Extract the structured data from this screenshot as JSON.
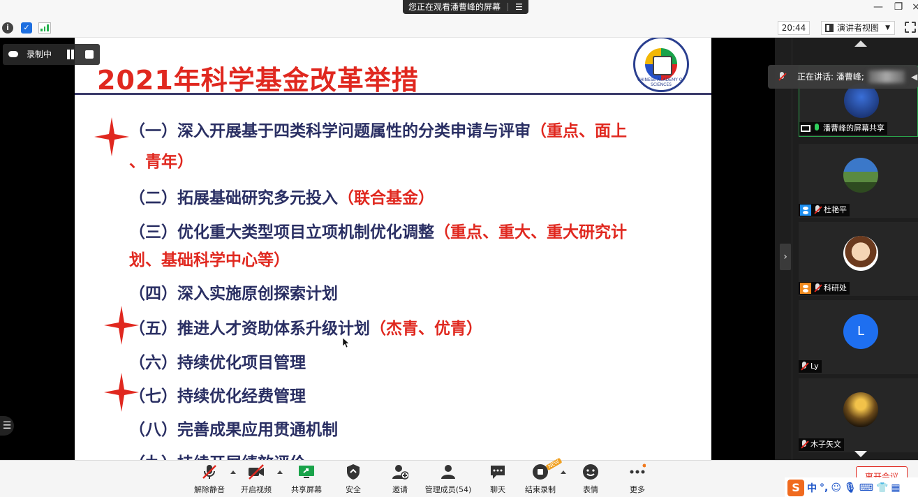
{
  "window": {
    "share_banner": "您正在观看潘曹峰的屏幕",
    "menu_glyph": "☰"
  },
  "toolbar": {
    "clock": "20:44",
    "view_mode": "演讲者视图"
  },
  "recording_badge": {
    "label": "录制中"
  },
  "slide": {
    "title": "2021年科学基金改革举措",
    "logo_text": "CHINESE ACADEMY OF SCIENCES",
    "items": [
      {
        "text": "（一）深入开展基于四类科学问题属性的分类申请与评审",
        "red": "（重点、面上",
        "cont": "、青年）"
      },
      {
        "text": "（二）拓展基础研究多元投入",
        "red": "（联合基金）"
      },
      {
        "text": "（三）优化重大类型项目立项机制优化调整",
        "red": "（重点、重大、重大研究计",
        "cont": "划、基础科学中心等）"
      },
      {
        "text": "（四）深入实施原创探索计划",
        "red": ""
      },
      {
        "text": "（五）推进人才资助体系升级计划",
        "red": "（杰青、优青）"
      },
      {
        "text": "（六）持续优化项目管理",
        "red": ""
      },
      {
        "text": "（七）持续优化经费管理",
        "red": ""
      },
      {
        "text": "（八）完善成果应用贯通机制",
        "red": ""
      },
      {
        "text": "（九）持续开展绩效评价",
        "red": ""
      }
    ]
  },
  "speaking": {
    "label": "正在讲话: 潘曹峰;"
  },
  "gallery": {
    "tiles": [
      {
        "name": "潘曹峰的屏幕共享"
      },
      {
        "name": "杜艳平"
      },
      {
        "name": "科研处"
      },
      {
        "name": "Ly",
        "initial": "L"
      },
      {
        "name": "木子矢文"
      }
    ]
  },
  "bottombar": {
    "unmute": "解除静音",
    "start_video": "开启视频",
    "share_screen": "共享屏幕",
    "security": "安全",
    "invite": "邀请",
    "manage_members": "管理成员(54)",
    "chat": "聊天",
    "end_recording": "结束录制",
    "new_badge": "NEW",
    "reactions": "表情",
    "more": "更多",
    "leave": "离开会议"
  },
  "ime": {
    "logo": "S",
    "lang": "中",
    "punct": "°,"
  },
  "colors": {
    "title_red": "#e0281f",
    "body_navy": "#2a2f63",
    "active_green": "#2aa54b"
  }
}
